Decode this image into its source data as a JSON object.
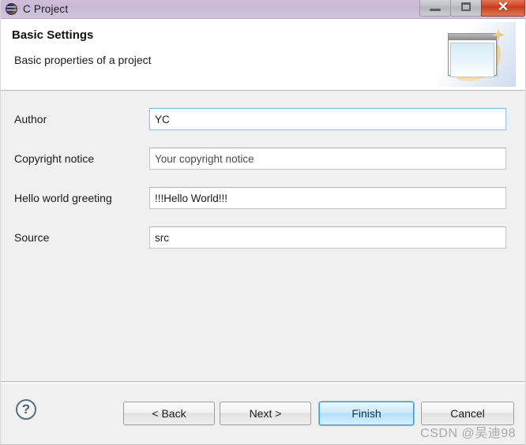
{
  "window": {
    "title": "C Project",
    "app_icon": "eclipse-icon",
    "controls": {
      "minimize_label": "–",
      "restore_label": "❐",
      "close_label": "✕"
    }
  },
  "header": {
    "title": "Basic Settings",
    "description": "Basic properties of a project",
    "banner_icon": "wizard-window-sparkle-icon"
  },
  "form": {
    "fields": [
      {
        "label": "Author",
        "value": "YC",
        "placeholder": "",
        "focused": true,
        "muted": false
      },
      {
        "label": "Copyright notice",
        "value": "Your copyright notice",
        "placeholder": "",
        "focused": false,
        "muted": true
      },
      {
        "label": "Hello world greeting",
        "value": "!!!Hello World!!!",
        "placeholder": "",
        "focused": false,
        "muted": false
      },
      {
        "label": "Source",
        "value": "src",
        "placeholder": "",
        "focused": false,
        "muted": false
      }
    ]
  },
  "footer": {
    "help_label": "?",
    "buttons": {
      "back": "< Back",
      "next": "Next >",
      "finish": "Finish",
      "cancel": "Cancel"
    }
  },
  "watermark": {
    "text": "CSDN @吴迪98"
  },
  "colors": {
    "titlebar": "#c8b8d4",
    "body_bg": "#f0f0f0",
    "primary_button_border": "#3c9cd9",
    "focus_border": "#9cc0dd",
    "close_button": "#d4492a"
  }
}
